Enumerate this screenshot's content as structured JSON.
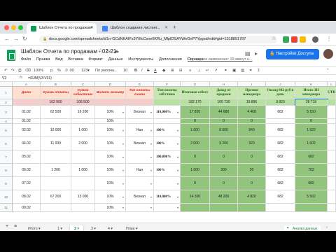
{
  "browser": {
    "tabs": [
      {
        "title": "Шаблон Отчета по продажам",
        "icon_color": "#0f9d58"
      },
      {
        "title": "Шаблон создания листинг...",
        "icon_color": "#4285f4"
      }
    ],
    "url": "docs.google.com/spreadsheets/d/1n-GCdNKAIFs3Y0fcCsne6KRu_MlpIDSAYWeGnP7Ypgsd/edit#gid=1318891787"
  },
  "doc": {
    "title": "Шаблон Отчета по продажам - 02-21",
    "menu": [
      "Файл",
      "Правка",
      "Вид",
      "Вставка",
      "Формат",
      "Данные",
      "Инструменты",
      "Дополнения",
      "Справка"
    ],
    "last_edit": "Последнее изменение: 19 минут н...",
    "share_label": "Настройки Доступа"
  },
  "toolbar": {
    "zoom": "100%",
    "currency": "р.",
    "percent": "%",
    "decimals": ".0  .00",
    "format": "123▾",
    "font": "По умолча...",
    "size": "10"
  },
  "formula_bar": {
    "cell_ref": "V2",
    "fx": "fx",
    "formula": "=SUM(V3:V31)"
  },
  "grid": {
    "columns": [
      "",
      "A",
      "B",
      "C",
      "D",
      "E",
      "F",
      "G",
      "H",
      "I",
      "J",
      "K",
      "L"
    ],
    "headers": [
      "Дата",
      "Сумма оплаты",
      "Сумма себестоим",
      "Валют. вознагр",
      "Тип оплаты счета",
      "Тип оплаты себ/стоим",
      "Итоговая себест",
      "Доход от продажи",
      "Премия менеджера",
      "Оклад 682 руб в день",
      "Итого ЗП менеджера",
      "UTB"
    ],
    "totals": [
      "",
      "162 900",
      "106 500",
      "",
      "",
      "",
      "182 170",
      "100 730",
      "19 896",
      "9 820",
      "28 718",
      ""
    ],
    "rows": [
      {
        "n": "3",
        "date": "01.02",
        "sum": "62 500",
        "cost": "16 200",
        "pct": "10%",
        "type": "Безнал",
        "type2": "110,000%",
        "total": "17 820",
        "income": "44 680",
        "bonus": "4 468",
        "salary": "682",
        "zp": "5 150"
      },
      {
        "n": "4",
        "date": "01.02",
        "sum": "",
        "cost": "",
        "pct": "10%",
        "type": "",
        "type2": "",
        "total": "0",
        "income": "0",
        "bonus": "0",
        "salary": "",
        "zp": "0"
      },
      {
        "n": "5",
        "date": "02.02",
        "sum": "10 000",
        "cost": "1 000",
        "pct": "10%",
        "type": "Нал",
        "type2": "100%",
        "total": "1 000",
        "income": "8 000",
        "bonus": "840",
        "salary": "682",
        "zp": "1 522"
      },
      {
        "n": "6",
        "date": "04.02",
        "sum": "11 000",
        "cost": "2 000",
        "pct": "10%",
        "type": "Безнал",
        "type2": "100%",
        "total": "2 000",
        "income": "9 200",
        "bonus": "920",
        "salary": "682",
        "zp": "1 602"
      },
      {
        "n": "7",
        "date": "05.02",
        "sum": "",
        "cost": "",
        "pct": "10%",
        "type": "",
        "type2": "100,000%",
        "total": "0",
        "income": "0",
        "bonus": "0",
        "salary": "682",
        "zp": "682"
      },
      {
        "n": "8",
        "date": "06.02",
        "sum": "1 200",
        "cost": "1 000",
        "pct": "10%",
        "type": "Нал",
        "type2": "100%",
        "total": "1 000",
        "income": "200",
        "bonus": "20",
        "salary": "682",
        "zp": "702"
      },
      {
        "n": "9",
        "date": "07.02",
        "sum": "",
        "cost": "",
        "pct": "10%",
        "type": "",
        "type2": "",
        "total": "0",
        "income": "0",
        "bonus": "0",
        "salary": "682",
        "zp": "682"
      },
      {
        "n": "10",
        "date": "08.02",
        "sum": "67 200",
        "cost": "13 000",
        "pct": "10%",
        "type": "Безнал",
        "type2": "110,000%",
        "total": "14 300",
        "income": "48 200",
        "bonus": "4 820",
        "salary": "682",
        "zp": "5 502"
      },
      {
        "n": "11",
        "date": "09.02",
        "sum": "",
        "cost": "",
        "pct": "10%",
        "type": "",
        "type2": "",
        "total": "",
        "income": "",
        "bonus": "",
        "salary": "",
        "zp": ""
      }
    ]
  },
  "sheets": {
    "add": "+",
    "list": "≡",
    "tabs": [
      "Итого",
      "1",
      "2",
      "3",
      "4",
      "План"
    ],
    "active": "2",
    "explore": "Анализ данных"
  },
  "colors": {
    "accent_green": "#0f9d58",
    "share_blue": "#1a73e8",
    "header_pink": "#ffe0d0",
    "header_green": "#c8e6b0",
    "cell_green": "#93c47d"
  }
}
